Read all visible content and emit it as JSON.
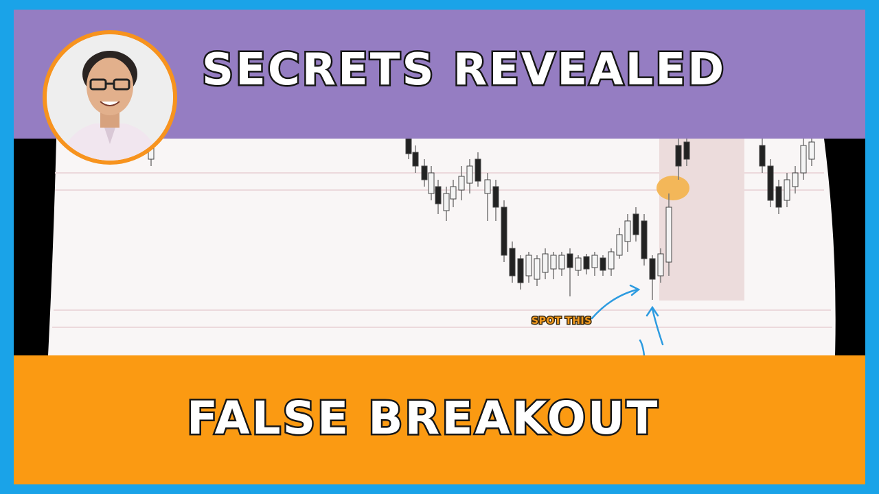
{
  "header": {
    "title": "SECRETS REVEALED"
  },
  "footer": {
    "title": "FALSE BREAKOUT"
  },
  "annotation": {
    "label": "SPOT THIS"
  },
  "colors": {
    "border": "#1aa3e8",
    "top_band": "#957dc2",
    "bottom_band": "#fb9a12",
    "avatar_ring": "#f7931e",
    "headline_text": "#ffffff",
    "headline_outline": "#1a1a1a",
    "callout_text": "#f39a1e",
    "arrow": "#2d9be0"
  },
  "icons": {
    "avatar": "presenter-avatar",
    "arrow": "curved-arrow-icon"
  }
}
